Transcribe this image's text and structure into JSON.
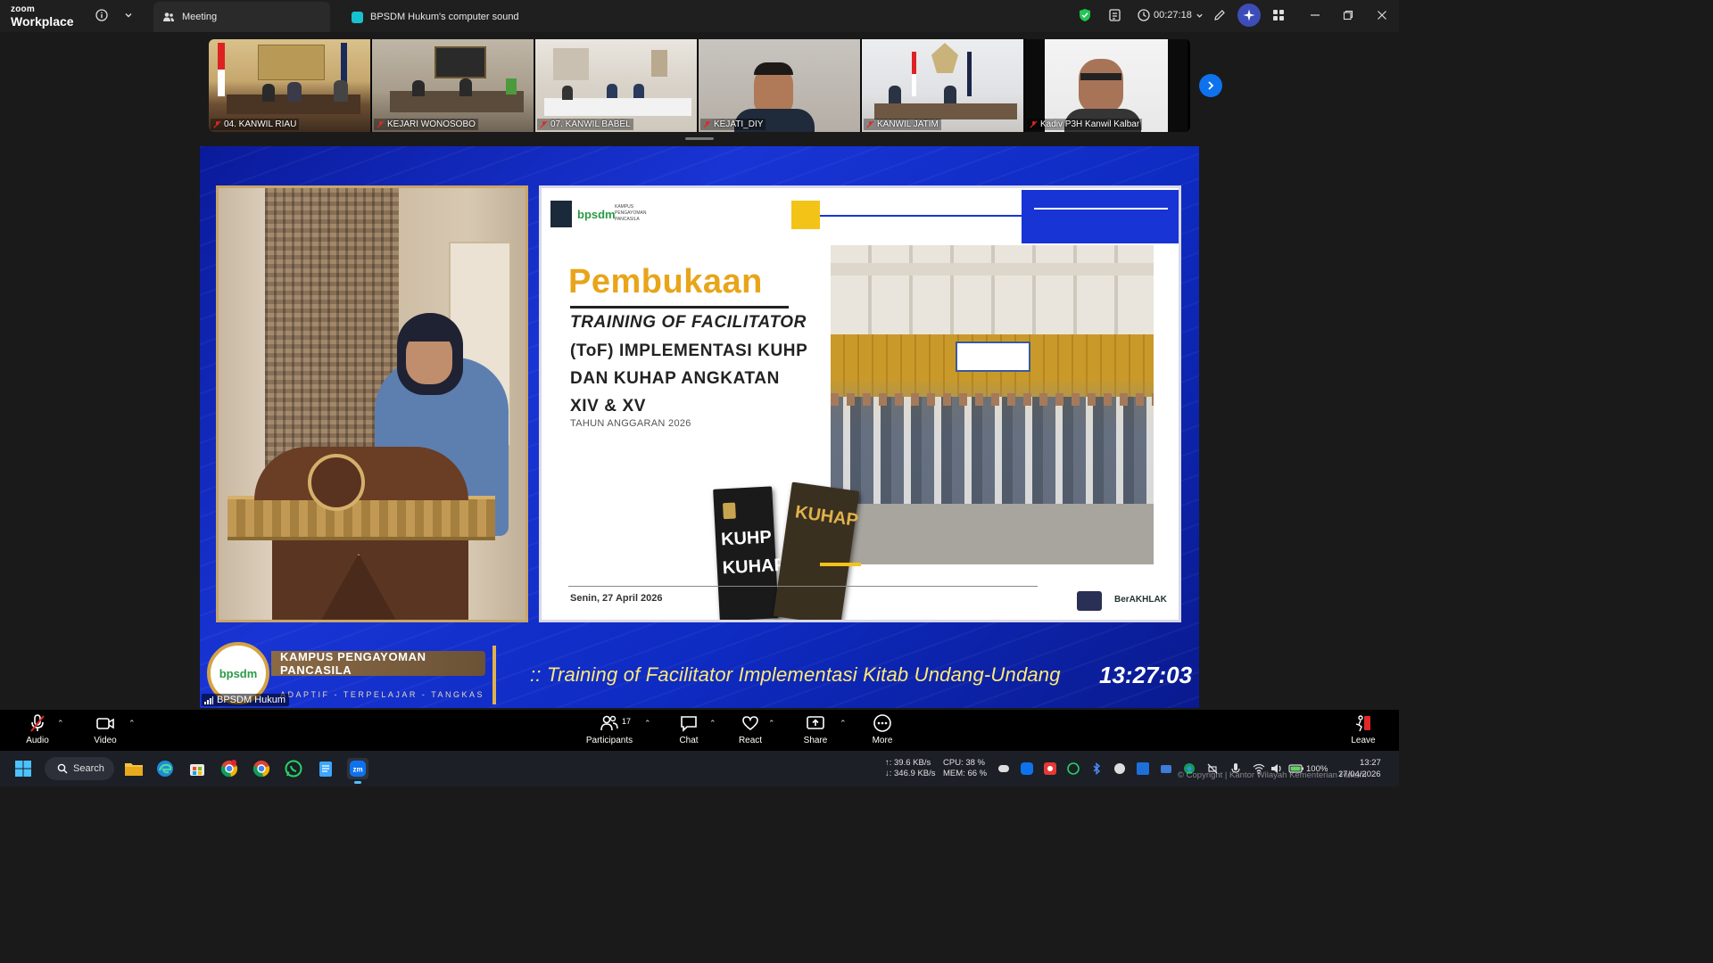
{
  "titlebar": {
    "brand_top": "zoom",
    "brand_bottom": "Workplace",
    "tabs": [
      {
        "label": "Meeting"
      },
      {
        "label": "BPSDM Hukum's computer sound"
      }
    ],
    "timer": "00:27:18"
  },
  "gallery": {
    "participants": [
      {
        "name": "04. KANWIL RIAU"
      },
      {
        "name": "KEJARI WONOSOBO"
      },
      {
        "name": "07. KANWIL BABEL"
      },
      {
        "name": "KEJATI_DIY"
      },
      {
        "name": "KANWIL JATIM"
      },
      {
        "name": "Kadiv P3H Kanwil Kalbar"
      }
    ]
  },
  "stage": {
    "name_label": "BPSDM Hukum",
    "slide": {
      "logo_text": "bpsdm",
      "logo_sub": "KAMPUS PENGAYOMAN PANCASILA",
      "title": "Pembukaan",
      "line1": "TRAINING OF FACILITATOR",
      "line2": "(ToF) IMPLEMENTASI KUHP",
      "line3": "DAN KUHAP ANGKATAN",
      "line4": "XIV & XV",
      "year": "TAHUN ANGGARAN 2026",
      "date": "Senin, 27 April 2026",
      "book1": "KUHP",
      "book1b": "KUHAP",
      "book2": "KUHAP",
      "footer_logo": "BerAKHLAK"
    },
    "lower_third": {
      "logo": "bpsdm",
      "title": "KAMPUS PENGAYOMAN PANCASILA",
      "tagline": "ADAPTIF - TERPELAJAR - TANGKAS"
    },
    "ticker": ":: Training of Facilitator Implementasi Kitab Undang-Undang",
    "clock": "13:27:03"
  },
  "controls": {
    "audio": "Audio",
    "video": "Video",
    "participants": "Participants",
    "participants_count": "17",
    "chat": "Chat",
    "react": "React",
    "share": "Share",
    "more": "More",
    "leave": "Leave"
  },
  "taskbar": {
    "search": "Search",
    "net_up": "↑: 39.6 KB/s",
    "net_down": "↓: 346.9 KB/s",
    "cpu": "CPU: 38 %",
    "mem": "MEM: 66 %",
    "battery": "100%",
    "time": "13:27",
    "date": "27/04/2026",
    "copyright": "© Copyright | Kantor Wilayah Kementerian Hukum"
  },
  "colors": {
    "zoom_blue": "#0e72ed",
    "stage_blue": "#1834d4",
    "slide_orange": "#e8a51a",
    "ticker_yellow": "#ffe878",
    "mute_red": "#e02828",
    "shield_green": "#23c552"
  }
}
